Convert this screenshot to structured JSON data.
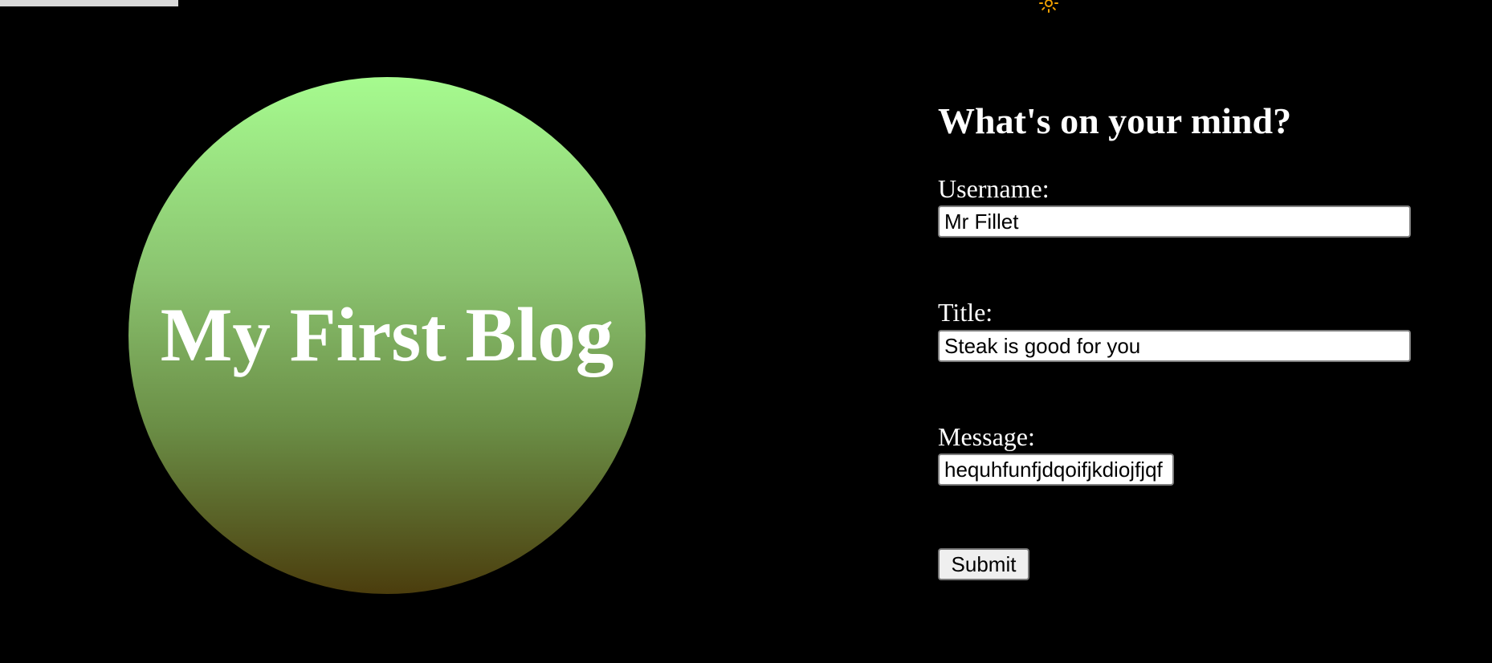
{
  "colors": {
    "background": "#000000",
    "hero_gradient_top": "#a6fb8f",
    "hero_gradient_bottom": "#4b3d0d",
    "text": "#ffffff",
    "sun_icon": "#f0a000"
  },
  "header": {
    "theme_icon": "sun-icon"
  },
  "hero": {
    "title": "My First Blog"
  },
  "form": {
    "heading": "What's on your mind?",
    "username_label": "Username:",
    "username_value": "Mr Fillet",
    "title_label": "Title:",
    "title_value": "Steak is good for you",
    "message_label": "Message:",
    "message_value": "hequhfunfjdqoifjkdiojfjqf",
    "submit_label": "Submit"
  }
}
